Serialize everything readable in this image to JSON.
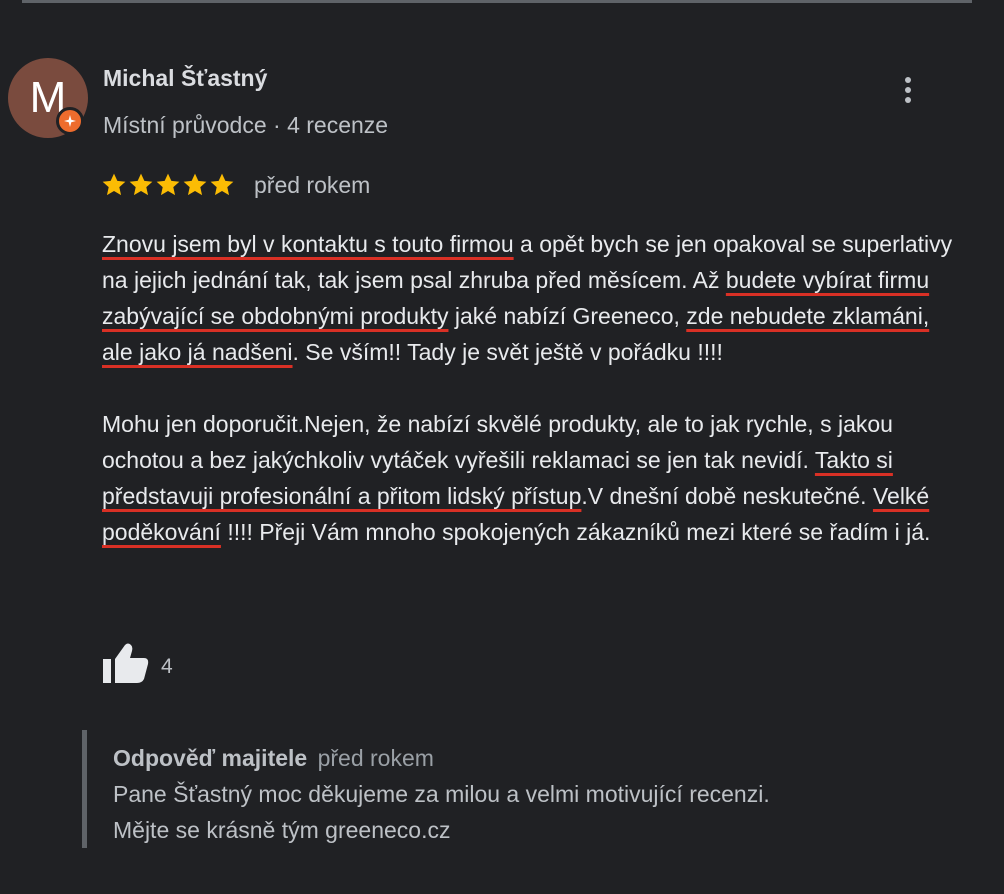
{
  "reviewer": {
    "name": "Michal Šťastný",
    "avatar_letter": "M",
    "meta": "Místní průvodce · 4 recenze"
  },
  "rating": {
    "stars": 5,
    "max_stars": 5,
    "star_color": "#fbbc04"
  },
  "review": {
    "date": "před rokem",
    "p1": {
      "s1": "Znovu jsem byl v kontaktu s touto firmou",
      "s2": " a opět bych se jen opakoval se superlativy na jejich jednání tak, tak jsem psal zhruba před měsícem. Až ",
      "s3": "budete vybírat firmu zabývající se obdobnými produkty",
      "s4": " jaké nabízí Greeneco, ",
      "s5": "zde nebudete zklamáni, ale jako já nadšeni",
      "s6": ". Se vším!! Tady je svět ještě v pořádku !!!!"
    },
    "p2": {
      "s1": "Mohu jen doporučit.Nejen, že nabízí skvělé produkty, ale to jak rychle, s jakou ochotou a bez jakýchkoliv vytáček vyřešili reklamaci se jen tak nevidí. ",
      "s2": "Takto si představuji profesionální a přitom lidský přístup",
      "s3": ".V dnešní době neskutečné. ",
      "s4": "Velké poděkování",
      "s5": " !!!! Přeji Vám mnoho spokojených zákazníků mezi které se řadím i já."
    },
    "highlight_color": "#d93025"
  },
  "like": {
    "count": "4"
  },
  "owner_reply": {
    "label": "Odpověď majitele",
    "date": "před rokem",
    "line1": "Pane Šťastný moc děkujeme za milou a velmi motivující recenzi.",
    "line2": "Mějte se krásně tým greeneco.cz"
  },
  "colors": {
    "background": "#202124",
    "avatar": "#7a4b3e",
    "local_guide_badge": "#ee6c2d"
  },
  "icons": {
    "more": "more-vert-icon",
    "like": "thumbs-up-icon",
    "badge": "local-guide-badge-icon",
    "star": "star-icon"
  }
}
